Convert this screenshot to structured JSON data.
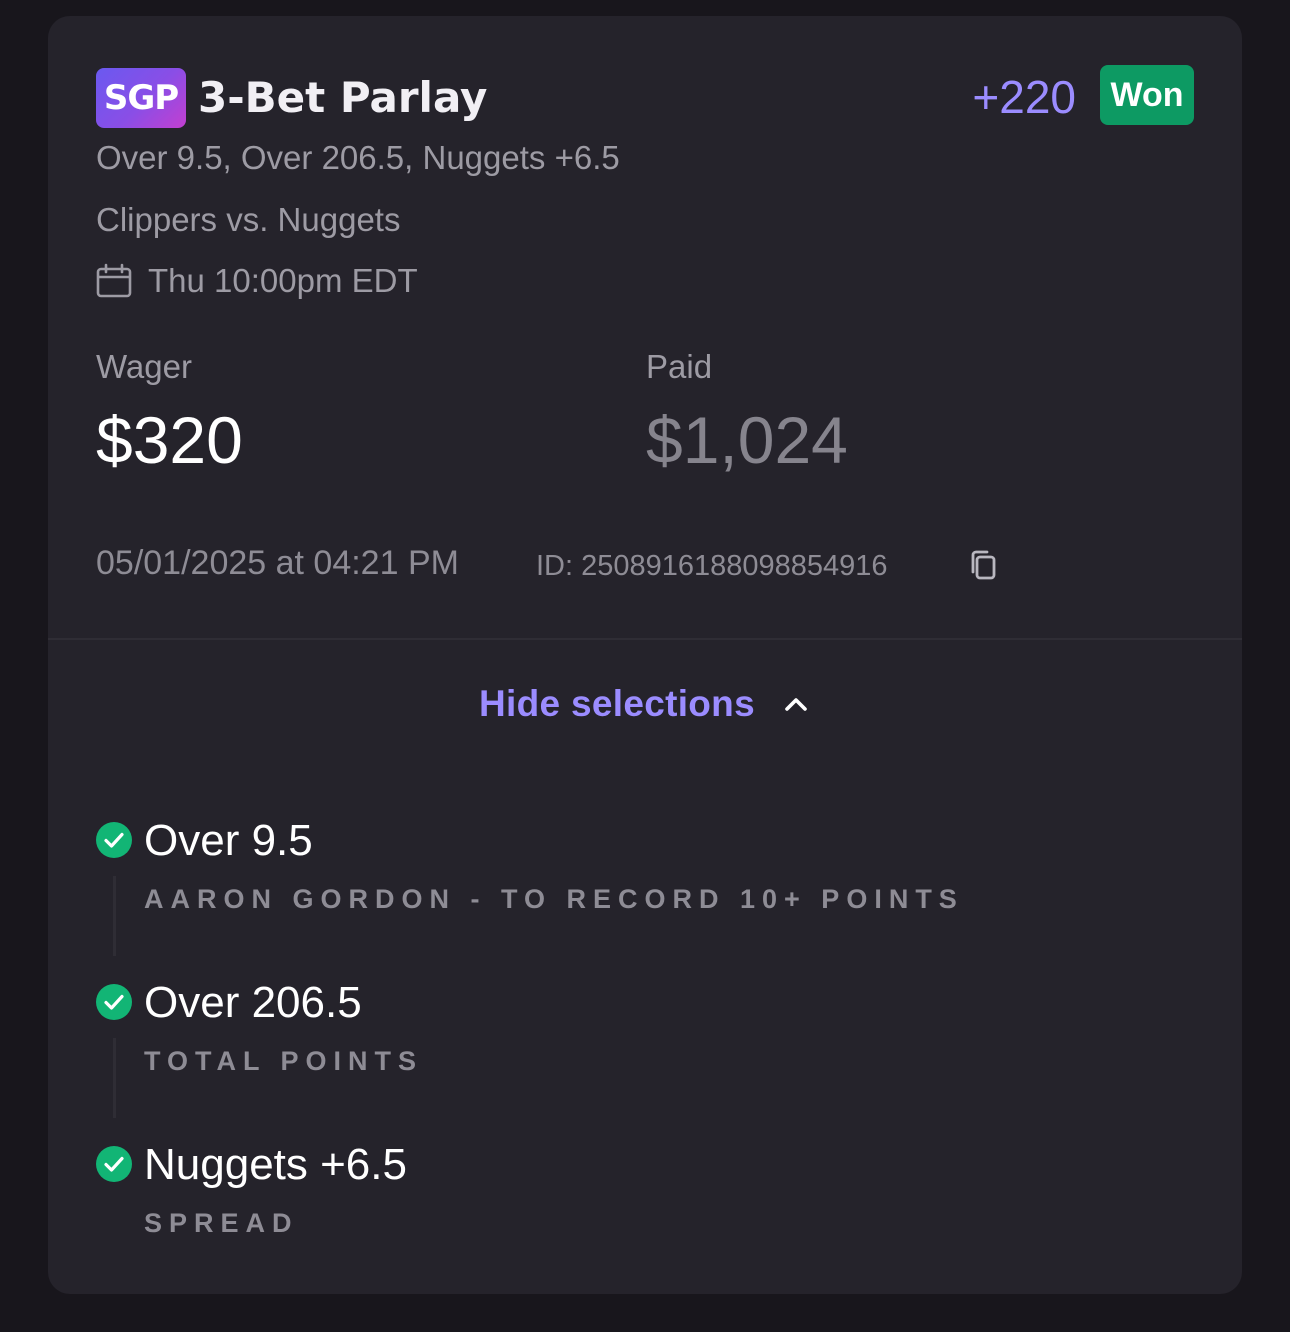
{
  "bet": {
    "badge": "SGP",
    "title": "3-Bet Parlay",
    "odds": "+220",
    "status": "Won",
    "legs_summary": "Over 9.5, Over 206.5, Nuggets +6.5",
    "matchup": "Clippers vs. Nuggets",
    "event_time": "Thu 10:00pm EDT"
  },
  "amounts": {
    "wager_label": "Wager",
    "wager_value": "$320",
    "paid_label": "Paid",
    "paid_value": "$1,024"
  },
  "meta": {
    "placed_at": "05/01/2025 at 04:21 PM",
    "bet_id": "ID: 2508916188098854916"
  },
  "toggle": {
    "label": "Hide selections"
  },
  "selections": [
    {
      "title": "Over 9.5",
      "market": "AARON GORDON - TO RECORD 10+ POINTS",
      "result": "won"
    },
    {
      "title": "Over 206.5",
      "market": "TOTAL POINTS",
      "result": "won"
    },
    {
      "title": "Nuggets +6.5",
      "market": "SPREAD",
      "result": "won"
    }
  ],
  "icons": {
    "calendar": "calendar-icon",
    "copy": "copy-icon",
    "chevron": "chevron-up-icon",
    "check": "check-circle-icon"
  },
  "colors": {
    "accent": "#9b8cff",
    "won": "#0d9a63",
    "check": "#12b575",
    "card_bg": "#25232b",
    "page_bg": "#18161c"
  }
}
